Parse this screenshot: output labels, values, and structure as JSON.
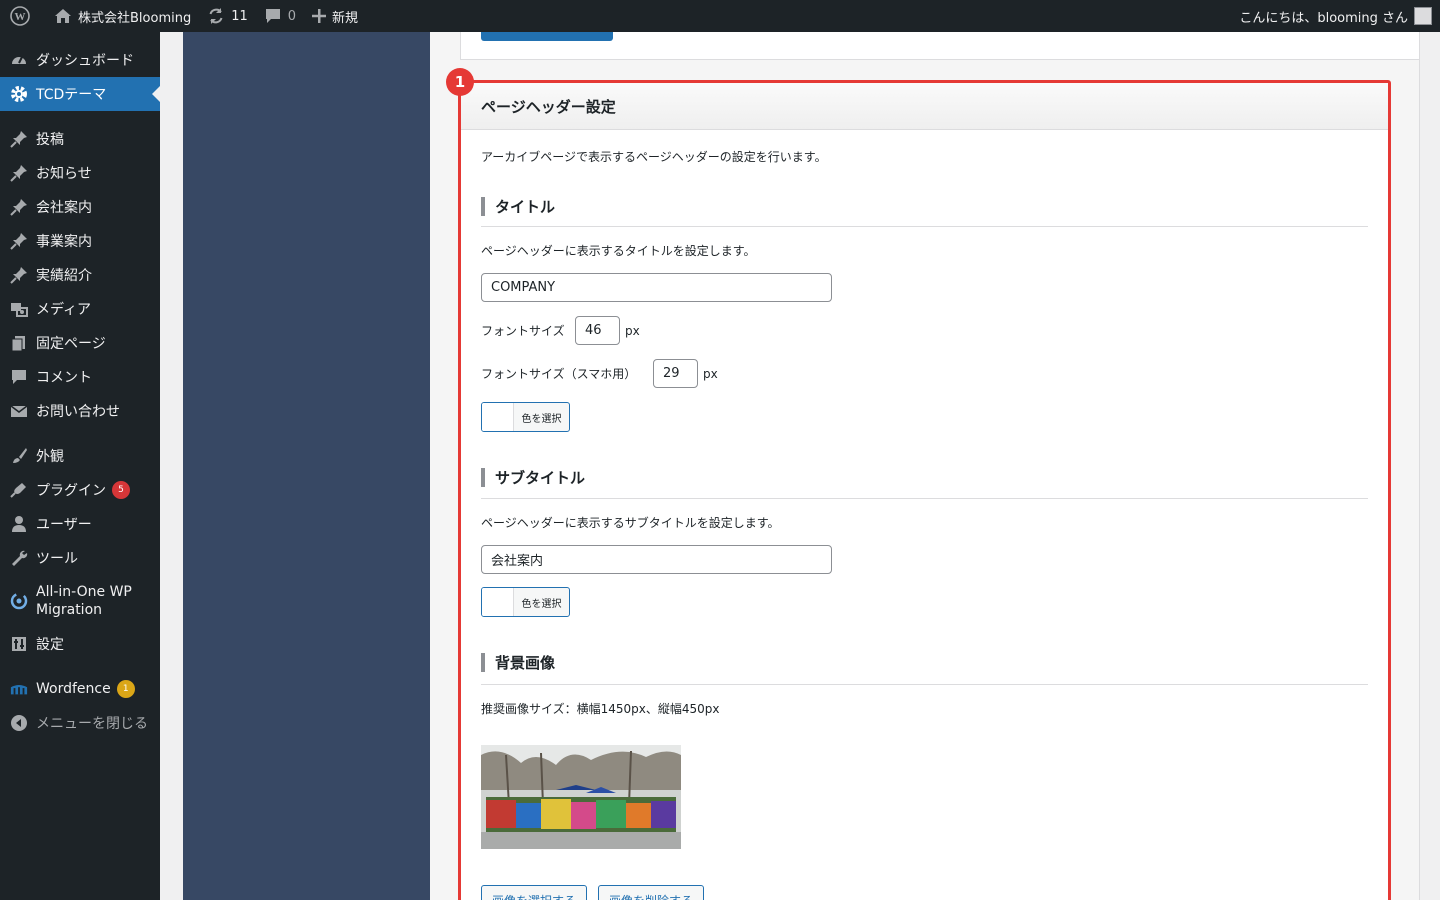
{
  "adminbar": {
    "site_name": "株式会社Blooming",
    "updates": "11",
    "comments": "0",
    "new_label": "新規",
    "greeting": "こんにちは、blooming さん"
  },
  "sidebar": {
    "items": [
      {
        "label": "ダッシュボード",
        "icon": "dashboard-icon"
      },
      {
        "label": "TCDテーマ",
        "icon": "gear-icon"
      },
      {
        "label": "投稿",
        "icon": "pin-icon"
      },
      {
        "label": "お知らせ",
        "icon": "pin-icon"
      },
      {
        "label": "会社案内",
        "icon": "pin-icon"
      },
      {
        "label": "事業案内",
        "icon": "pin-icon"
      },
      {
        "label": "実績紹介",
        "icon": "pin-icon"
      },
      {
        "label": "メディア",
        "icon": "media-icon"
      },
      {
        "label": "固定ページ",
        "icon": "page-icon"
      },
      {
        "label": "コメント",
        "icon": "comment-icon"
      },
      {
        "label": "お問い合わせ",
        "icon": "mail-icon"
      },
      {
        "label": "外観",
        "icon": "brush-icon"
      },
      {
        "label": "プラグイン",
        "icon": "plugin-icon",
        "badge": "5"
      },
      {
        "label": "ユーザー",
        "icon": "user-icon"
      },
      {
        "label": "ツール",
        "icon": "wrench-icon"
      },
      {
        "label": "All-in-One WP Migration",
        "icon": "migration-icon"
      },
      {
        "label": "設定",
        "icon": "settings-icon"
      },
      {
        "label": "Wordfence",
        "icon": "wordfence-icon",
        "badge": "1"
      },
      {
        "label": "メニューを閉じる",
        "icon": "collapse-icon"
      }
    ]
  },
  "section": {
    "marker": "1",
    "title": "ページヘッダー設定",
    "description": "アーカイブページで表示するページヘッダーの設定を行います。",
    "title_group": {
      "heading": "タイトル",
      "description": "ページヘッダーに表示するタイトルを設定します。",
      "value": "COMPANY",
      "font_size_label": "フォントサイズ",
      "font_size": "46",
      "font_size_sp_label": "フォントサイズ（スマホ用）",
      "font_size_sp": "29",
      "unit": "px",
      "color_button": "色を選択"
    },
    "subtitle_group": {
      "heading": "サブタイトル",
      "description": "ページヘッダーに表示するサブタイトルを設定します。",
      "value": "会社案内",
      "color_button": "色を選択"
    },
    "background_group": {
      "heading": "背景画像",
      "description": "推奨画像サイズ：横幅1450px、縦幅450px",
      "select_button": "画像を選択する",
      "delete_button": "画像を削除する"
    }
  },
  "colors": {
    "accent": "#2271b1",
    "highlight": "#e53935",
    "admin_dark": "#1d2327"
  }
}
